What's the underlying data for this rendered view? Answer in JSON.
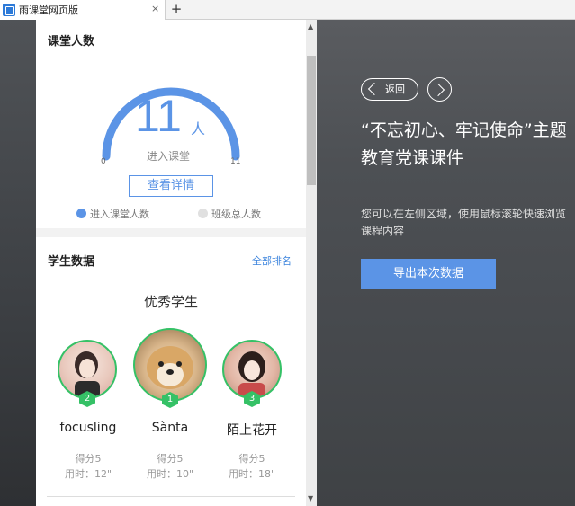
{
  "browser": {
    "tab_title": "雨课堂网页版",
    "close_glyph": "×",
    "add_glyph": "+"
  },
  "attendance": {
    "title": "课堂人数",
    "count": "11",
    "unit": "人",
    "label": "进入课堂",
    "min": "0",
    "max": "11",
    "fill_fraction": 1.0,
    "detail_button": "查看详情",
    "legend": [
      "进入课堂人数",
      "班级总人数"
    ],
    "colors": {
      "entered": "#5b94e6",
      "total": "#e0e0e0"
    }
  },
  "students": {
    "title": "学生数据",
    "rank_link": "全部排名",
    "subtitle": "优秀学生",
    "top": [
      {
        "rank": "2",
        "name": "focusling",
        "score": "得分5",
        "time": "用时：12\""
      },
      {
        "rank": "1",
        "name": "Sànta",
        "score": "得分5",
        "time": "用时：10\""
      },
      {
        "rank": "3",
        "name": "陌上花开",
        "score": "得分5",
        "time": "用时：18\""
      }
    ],
    "accent": "#35c166"
  },
  "scroll": {
    "up": "▲",
    "down": "▼"
  },
  "slide": {
    "back_label": "返回",
    "title": "“不忘初心、牢记使命”主题教育党课课件",
    "hint": "您可以在左侧区域，使用鼠标滚轮快速浏览课程内容",
    "export_button": "导出本次数据"
  }
}
